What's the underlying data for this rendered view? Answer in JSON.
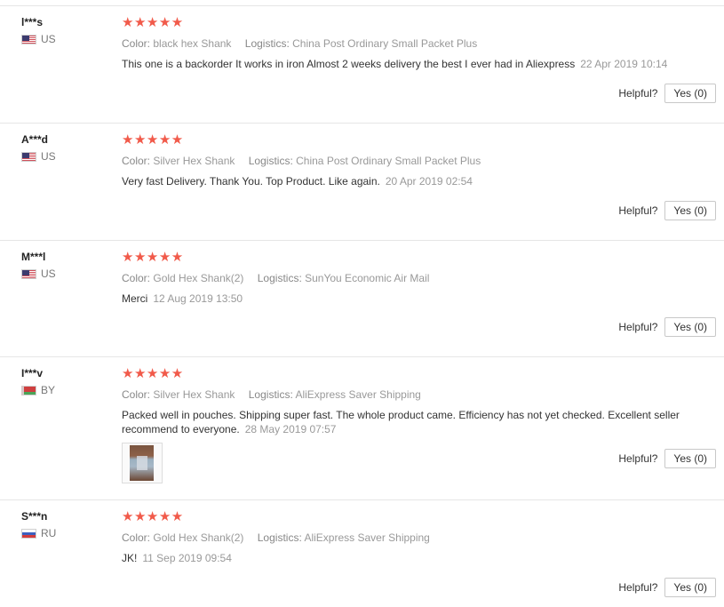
{
  "helpful_label": "Helpful?",
  "reviews": [
    {
      "user": "l***s",
      "country": "US",
      "stars": "★★★★★",
      "color_label": "Color:",
      "color": "black hex Shank",
      "logistics_label": "Logistics:",
      "logistics": "China Post Ordinary Small Packet Plus",
      "text": "This one is a backorder It works in iron Almost 2 weeks delivery the best I ever had in Aliexpress",
      "date": "22 Apr 2019 10:14",
      "yes": "Yes (0)"
    },
    {
      "user": "A***d",
      "country": "US",
      "stars": "★★★★★",
      "color_label": "Color:",
      "color": "Silver Hex Shank",
      "logistics_label": "Logistics:",
      "logistics": "China Post Ordinary Small Packet Plus",
      "text": "Very fast Delivery. Thank You. Top Product. Like again.",
      "date": "20 Apr 2019 02:54",
      "yes": "Yes (0)"
    },
    {
      "user": "M***l",
      "country": "US",
      "stars": "★★★★★",
      "color_label": "Color:",
      "color": "Gold Hex Shank(2)",
      "logistics_label": "Logistics:",
      "logistics": "SunYou Economic Air Mail",
      "text": "Merci",
      "date": "12 Aug 2019 13:50",
      "yes": "Yes (0)"
    },
    {
      "user": "I***v",
      "country": "BY",
      "stars": "★★★★★",
      "color_label": "Color:",
      "color": "Silver Hex Shank",
      "logistics_label": "Logistics:",
      "logistics": "AliExpress Saver Shipping",
      "text": "Packed well in pouches. Shipping super fast. The whole product came. Efficiency has not yet checked. Excellent seller recommend to everyone.",
      "date": "28 May 2019 07:57",
      "yes": "Yes (0)",
      "has_photo": true
    },
    {
      "user": "S***n",
      "country": "RU",
      "stars": "★★★★★",
      "color_label": "Color:",
      "color": "Gold Hex Shank(2)",
      "logistics_label": "Logistics:",
      "logistics": "AliExpress Saver Shipping",
      "text": "JK!",
      "date": "11 Sep 2019 09:54",
      "yes": "Yes (0)"
    }
  ]
}
